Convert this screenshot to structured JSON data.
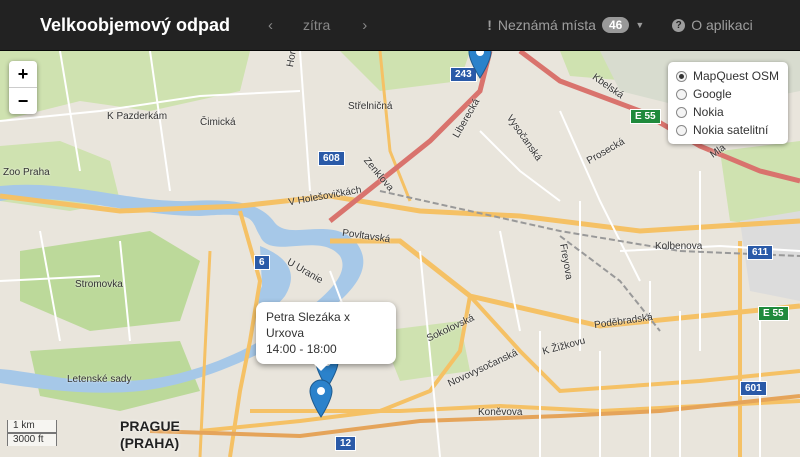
{
  "navbar": {
    "brand": "Velkoobjemový odpad",
    "prev_icon": "‹",
    "day": "zítra",
    "next_icon": "›",
    "unknown_icon": "!",
    "unknown_label": "Neznámá místa",
    "unknown_count": "46",
    "about_label": "O aplikaci",
    "about_icon": "?"
  },
  "map": {
    "zoom_in": "+",
    "zoom_out": "−",
    "layers": [
      {
        "label": "MapQuest OSM",
        "selected": true
      },
      {
        "label": "Google",
        "selected": false
      },
      {
        "label": "Nokia",
        "selected": false
      },
      {
        "label": "Nokia satelitní",
        "selected": false
      }
    ],
    "popup": {
      "line1": "Petra Slezáka x Urxova",
      "line2": "14:00 - 18:00"
    },
    "scale": {
      "metric": "1 km",
      "imperial": "3000 ft"
    },
    "city": {
      "line1": "PRAGUE",
      "line2": "(PRAHA)"
    },
    "labels": {
      "kpazderkam": "K Pazderkám",
      "cimicka": "Čimická",
      "horni": "Horňátecká",
      "strelnicna": "Střelničná",
      "zoo": "Zoo Praha",
      "holesovickach": "V Holešovičkách",
      "zenklova": "Zenklova",
      "povltavska": "Povltavská",
      "stromovka": "Stromovka",
      "uurani": "U Uranie",
      "letenske": "Letenské sady",
      "sokolovska": "Sokolovská",
      "novovysocanska": "Novovysočanská",
      "kzizkovu": "K Žižkovu",
      "podebradska": "Poděbradská",
      "konevova": "Koněvova",
      "kolbenova": "Kolbenova",
      "freyova": "Freyova",
      "prosecka": "Prosecká",
      "vysocanska": "Vysočanská",
      "liberecka": "Liberecká",
      "kbelska": "Kbelská",
      "mla": "Mla"
    },
    "shields": {
      "r243": "243",
      "r608": "608",
      "r6": "6",
      "r611": "611",
      "e55a": "E 55",
      "e55b": "E 55",
      "r601": "601",
      "r12": "12"
    }
  }
}
